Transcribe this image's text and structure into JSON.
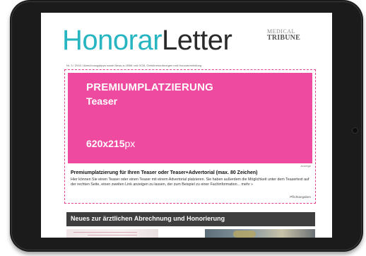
{
  "newsletter": {
    "logo_part1": "Honorar",
    "logo_part2": "Letter",
    "publisher_line1": "MEDICAL",
    "publisher_line2": "TRIBUNE",
    "issue_line": "Nr. 3 / 2016 / Abrechnungstipps sowie News zu EBM und GOÄ, Gebührenordnungen und Honorarverteilung"
  },
  "ad": {
    "title": "PREMIUMPLATZIERUNG",
    "subtitle": "Teaser",
    "size_bold": "620x215",
    "size_unit": "px",
    "small_tag": "Anzeige",
    "teaser_title": "Premiumplatzierung für Ihren Teaser oder Teaser+Advertorial (max. 80 Zeichen)",
    "teaser_text": "Hier können Sie einen Teaser oder einen Teaser mit einem Advertorial platzieren. Sie haben außerdem die Möglichkeit unter dem Teasertext auf der rechten Seite, einen zweiten Link anzeigen zu lassen, der zum Beispiel zu einer Fachinformation... ",
    "more_link": "mehr »",
    "teaser_tag": "Pflichtangaben"
  },
  "section": {
    "heading": "Neues zur ärztlichen Abrechnung und Honorierung"
  },
  "colors": {
    "logo_accent": "#27b5c2",
    "banner_pink": "#ee4aa0",
    "section_bar": "#3e3e3e",
    "device_body": "#1b1b1c"
  }
}
